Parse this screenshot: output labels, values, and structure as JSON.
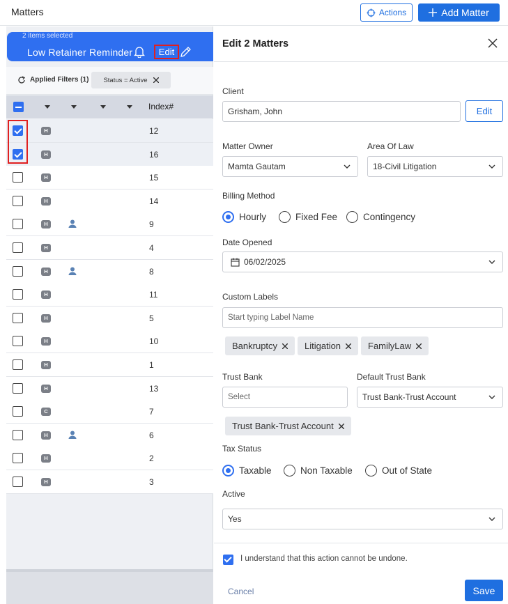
{
  "topbar": {
    "title": "Matters",
    "actions_label": "Actions",
    "add_label": "Add Matter"
  },
  "banner": {
    "selected_text": "2 items selected",
    "reminder_label": "Low Retainer Reminder",
    "edit_label": "Edit"
  },
  "filters": {
    "applied_label": "Applied Filters (1)",
    "chip_label": "Status = Active"
  },
  "table": {
    "index_header": "Index#",
    "rows": [
      {
        "index": "12",
        "badge": "H",
        "person": false,
        "checked": true
      },
      {
        "index": "16",
        "badge": "H",
        "person": false,
        "checked": true
      },
      {
        "index": "15",
        "badge": "H",
        "person": false,
        "checked": false
      },
      {
        "index": "14",
        "badge": "H",
        "person": false,
        "checked": false
      },
      {
        "index": "9",
        "badge": "H",
        "person": true,
        "checked": false
      },
      {
        "index": "4",
        "badge": "H",
        "person": false,
        "checked": false
      },
      {
        "index": "8",
        "badge": "H",
        "person": true,
        "checked": false
      },
      {
        "index": "11",
        "badge": "H",
        "person": false,
        "checked": false
      },
      {
        "index": "5",
        "badge": "H",
        "person": false,
        "checked": false
      },
      {
        "index": "10",
        "badge": "H",
        "person": false,
        "checked": false
      },
      {
        "index": "1",
        "badge": "H",
        "person": false,
        "checked": false
      },
      {
        "index": "13",
        "badge": "H",
        "person": false,
        "checked": false
      },
      {
        "index": "7",
        "badge": "C",
        "person": false,
        "checked": false
      },
      {
        "index": "6",
        "badge": "H",
        "person": true,
        "checked": false
      },
      {
        "index": "2",
        "badge": "H",
        "person": false,
        "checked": false
      },
      {
        "index": "3",
        "badge": "H",
        "person": false,
        "checked": false
      }
    ]
  },
  "panel": {
    "title": "Edit 2 Matters",
    "client": {
      "label": "Client",
      "value": "Grisham, John",
      "edit_label": "Edit"
    },
    "matter_owner": {
      "label": "Matter Owner",
      "value": "Mamta Gautam"
    },
    "area_of_law": {
      "label": "Area Of Law",
      "value": "18-Civil Litigation"
    },
    "billing": {
      "label": "Billing Method",
      "options": [
        "Hourly",
        "Fixed Fee",
        "Contingency"
      ],
      "selected": "Hourly"
    },
    "date_opened": {
      "label": "Date Opened",
      "value": "06/02/2025"
    },
    "custom_labels": {
      "label": "Custom Labels",
      "placeholder": "Start typing Label Name",
      "tags": [
        "Bankruptcy",
        "Litigation",
        "FamilyLaw"
      ]
    },
    "trust_bank": {
      "label": "Trust Bank",
      "placeholder": "Select",
      "tag": "Trust Bank-Trust Account"
    },
    "default_trust_bank": {
      "label": "Default Trust Bank",
      "value": "Trust Bank-Trust Account"
    },
    "tax": {
      "label": "Tax Status",
      "options": [
        "Taxable",
        "Non Taxable",
        "Out of State"
      ],
      "selected": "Taxable"
    },
    "active": {
      "label": "Active",
      "value": "Yes"
    },
    "acknowledge": {
      "text": "I understand that this action cannot be undone.",
      "checked": true
    },
    "cancel_label": "Cancel",
    "save_label": "Save"
  },
  "colors": {
    "primary": "#1f6fe0",
    "banner": "#2f6ff0",
    "highlight": "#e02020"
  }
}
